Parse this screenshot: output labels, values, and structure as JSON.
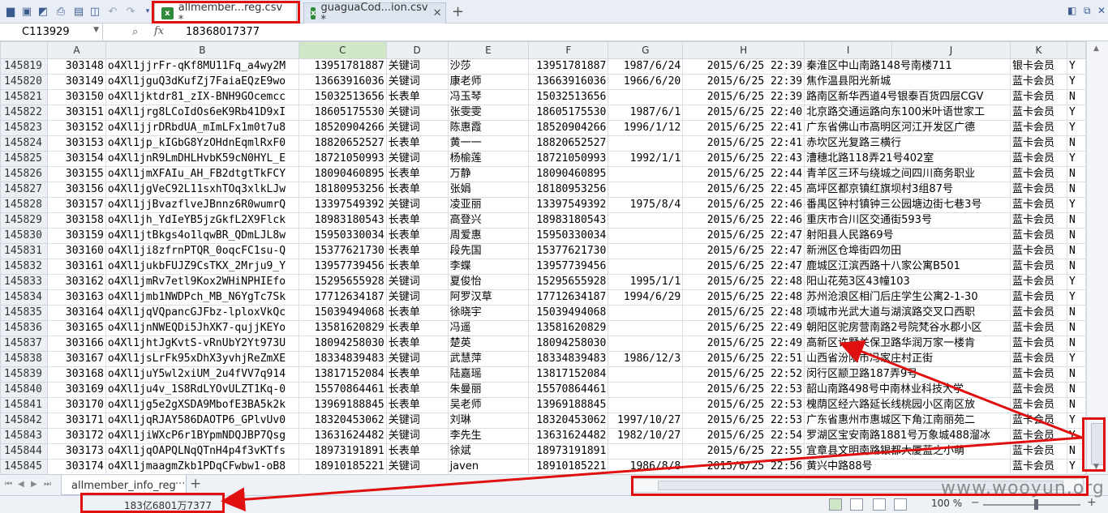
{
  "toolbar": {
    "icons": [
      "folder-icon",
      "save-icon",
      "pdf-icon",
      "print-icon",
      "print-preview-icon",
      "preview-icon",
      "undo-icon",
      "redo-icon",
      "customize-icon"
    ]
  },
  "tabs": [
    {
      "label": "allmember...reg.csv *",
      "active": true
    },
    {
      "label": "guaguaCod...ion.csv *",
      "active": false
    }
  ],
  "tab_close": "✕",
  "formula_bar": {
    "cell_ref": "C113929",
    "fx": "fx",
    "value": "18368017377"
  },
  "columns": [
    "A",
    "B",
    "C",
    "D",
    "E",
    "F",
    "G",
    "H",
    "I",
    "J",
    "K"
  ],
  "selected_column": "C",
  "rows": [
    {
      "n": "145819",
      "a": "303148",
      "b": "o4Xl1jjrFr-qKf8MU11Fq_a4wy2M",
      "c": "13951781887",
      "d": "关键词",
      "e": "沙莎",
      "f": "13951781887",
      "g": "1987/6/24",
      "h": "2015/6/25 22:39",
      "i": "秦淮区中山南路148号南楼711",
      "k": "银卡会员",
      "l": "Y"
    },
    {
      "n": "145820",
      "a": "303149",
      "b": "o4Xl1jguQ3dKufZj7FaiaEQzE9wo",
      "c": "13663916036",
      "d": "关键词",
      "e": "康老师",
      "f": "13663916036",
      "g": "1966/6/20",
      "h": "2015/6/25 22:39",
      "i": "焦作温县阳光新城",
      "k": "蓝卡会员",
      "l": "Y"
    },
    {
      "n": "145821",
      "a": "303150",
      "b": "o4Xl1jktdr81_zIX-BNH9GOcemcc",
      "c": "15032513656",
      "d": "长表单",
      "e": "冯玉琴",
      "f": "15032513656",
      "g": "",
      "h": "2015/6/25 22:39",
      "i": "路南区新华西道4号银泰百货四层CGV",
      "k": "蓝卡会员",
      "l": "N"
    },
    {
      "n": "145822",
      "a": "303151",
      "b": "o4Xl1jrg8LCoIdOs6eK9Rb41D9xI",
      "c": "18605175530",
      "d": "关键词",
      "e": "张雯雯",
      "f": "18605175530",
      "g": "1987/6/1",
      "h": "2015/6/25 22:40",
      "i": "北京路交通运路向东100米叶语世家工",
      "k": "蓝卡会员",
      "l": "Y"
    },
    {
      "n": "145823",
      "a": "303152",
      "b": "o4Xl1jjrDRbdUA_mImLFx1m0t7u8",
      "c": "18520904266",
      "d": "关键词",
      "e": "陈惠霞",
      "f": "18520904266",
      "g": "1996/1/12",
      "h": "2015/6/25 22:41",
      "i": "广东省佛山市高明区河江开发区广德",
      "k": "蓝卡会员",
      "l": "Y"
    },
    {
      "n": "145824",
      "a": "303153",
      "b": "o4Xl1jp_kIGbG8YzOHdnEqmlRxF0",
      "c": "18820652527",
      "d": "长表单",
      "e": "黄一一",
      "f": "18820652527",
      "g": "",
      "h": "2015/6/25 22:41",
      "i": "赤坎区光复路三横行",
      "k": "蓝卡会员",
      "l": "N"
    },
    {
      "n": "145825",
      "a": "303154",
      "b": "o4Xl1jnR9LmDHLHvbK59cN0HYL_E",
      "c": "18721050993",
      "d": "关键词",
      "e": "杨榆莲",
      "f": "18721050993",
      "g": "1992/1/1",
      "h": "2015/6/25 22:43",
      "i": "漕穗北路118弄21号402室",
      "k": "蓝卡会员",
      "l": "Y"
    },
    {
      "n": "145826",
      "a": "303155",
      "b": "o4Xl1jmXFAIu_AH_FB2dtgtTkFCY",
      "c": "18090460895",
      "d": "长表单",
      "e": "万静",
      "f": "18090460895",
      "g": "",
      "h": "2015/6/25 22:44",
      "i": "青羊区三环与绕城之间四川商务职业",
      "k": "蓝卡会员",
      "l": "N"
    },
    {
      "n": "145827",
      "a": "303156",
      "b": "o4Xl1jgVeC92L11sxhTOq3xlkLJw",
      "c": "18180953256",
      "d": "长表单",
      "e": "张娟",
      "f": "18180953256",
      "g": "",
      "h": "2015/6/25 22:45",
      "i": "高坪区都京镇红旗坝村3组87号",
      "k": "蓝卡会员",
      "l": "N"
    },
    {
      "n": "145828",
      "a": "303157",
      "b": "o4Xl1jjBvazflveJBnnz6R0wumrQ",
      "c": "13397549392",
      "d": "关键词",
      "e": "凌亚丽",
      "f": "13397549392",
      "g": "1975/8/4",
      "h": "2015/6/25 22:46",
      "i": "番禺区钟村镇钟三公园塘边街七巷3号",
      "k": "蓝卡会员",
      "l": "Y"
    },
    {
      "n": "145829",
      "a": "303158",
      "b": "o4Xl1jh_YdIeYB5jzGkfL2X9Flck",
      "c": "18983180543",
      "d": "长表单",
      "e": "高登兴",
      "f": "18983180543",
      "g": "",
      "h": "2015/6/25 22:46",
      "i": "重庆市合川区交通街593号",
      "k": "蓝卡会员",
      "l": "N"
    },
    {
      "n": "145830",
      "a": "303159",
      "b": "o4Xl1jtBkgs4o1lqwBR_QDmLJL8w",
      "c": "15950330034",
      "d": "长表单",
      "e": "周爱惠",
      "f": "15950330034",
      "g": "",
      "h": "2015/6/25 22:47",
      "i": "射阳县人民路69号",
      "k": "蓝卡会员",
      "l": "N"
    },
    {
      "n": "145831",
      "a": "303160",
      "b": "o4Xl1ji8zfrnPTQR_0oqcFC1su-Q",
      "c": "15377621730",
      "d": "长表单",
      "e": "段先国",
      "f": "15377621730",
      "g": "",
      "h": "2015/6/25 22:47",
      "i": "新洲区仓埠街四勿田",
      "k": "蓝卡会员",
      "l": "N"
    },
    {
      "n": "145832",
      "a": "303161",
      "b": "o4Xl1jukbFUJZ9CsTKX_2Mrju9_Y",
      "c": "13957739456",
      "d": "长表单",
      "e": "李蝶",
      "f": "13957739456",
      "g": "",
      "h": "2015/6/25 22:47",
      "i": "鹿城区江滨西路十八家公寓B501",
      "k": "蓝卡会员",
      "l": "N"
    },
    {
      "n": "145833",
      "a": "303162",
      "b": "o4Xl1jmRv7etl9Kox2WHiNPHIEfo",
      "c": "15295655928",
      "d": "关键词",
      "e": "夏俊怡",
      "f": "15295655928",
      "g": "1995/1/1",
      "h": "2015/6/25 22:48",
      "i": "阳山花苑3区43幢103",
      "k": "蓝卡会员",
      "l": "Y"
    },
    {
      "n": "145834",
      "a": "303163",
      "b": "o4Xl1jmb1NWDPch_MB_N6YgTc7Sk",
      "c": "17712634187",
      "d": "关键词",
      "e": "阿罗汉草",
      "f": "17712634187",
      "g": "1994/6/29",
      "h": "2015/6/25 22:48",
      "i": "苏州沧浪区相门后庄学生公寓2-1-30",
      "k": "蓝卡会员",
      "l": "Y"
    },
    {
      "n": "145835",
      "a": "303164",
      "b": "o4Xl1jqVQpancGJFbz-lploxVkQc",
      "c": "15039494068",
      "d": "长表单",
      "e": "徐晓宇",
      "f": "15039494068",
      "g": "",
      "h": "2015/6/25 22:48",
      "i": "项城市光武大道与湖滨路交叉口西职",
      "k": "蓝卡会员",
      "l": "N"
    },
    {
      "n": "145836",
      "a": "303165",
      "b": "o4Xl1jnNWEQDi5JhXK7-qujjKEYo",
      "c": "13581620829",
      "d": "长表单",
      "e": "冯遥",
      "f": "13581620829",
      "g": "",
      "h": "2015/6/25 22:49",
      "i": "朝阳区驼房营南路2号院梵谷水郡小区",
      "k": "蓝卡会员",
      "l": "N"
    },
    {
      "n": "145837",
      "a": "303166",
      "b": "o4Xl1jhtJgKvtS-vRnUbY2Yt973U",
      "c": "18094258030",
      "d": "长表单",
      "e": "楚英",
      "f": "18094258030",
      "g": "",
      "h": "2015/6/25 22:49",
      "i": "高新区许墅关保卫路华润万家一楼肯",
      "k": "蓝卡会员",
      "l": "N"
    },
    {
      "n": "145838",
      "a": "303167",
      "b": "o4Xl1jsLrFk95xDhX3yvhjReZmXE",
      "c": "18334839483",
      "d": "关键词",
      "e": "武慧萍",
      "f": "18334839483",
      "g": "1986/12/3",
      "h": "2015/6/25 22:51",
      "i": "山西省汾阳市冯家庄村正街",
      "k": "蓝卡会员",
      "l": "Y"
    },
    {
      "n": "145839",
      "a": "303168",
      "b": "o4Xl1juY5wl2xiUM_2u4fVV7q914",
      "c": "13817152084",
      "d": "长表单",
      "e": "陆嘉瑶",
      "f": "13817152084",
      "g": "",
      "h": "2015/6/25 22:52",
      "i": "闵行区颛卫路187弄9号",
      "k": "蓝卡会员",
      "l": "N"
    },
    {
      "n": "145840",
      "a": "303169",
      "b": "o4Xl1ju4v_1S8RdLYOvULZT1Kq-0",
      "c": "15570864461",
      "d": "长表单",
      "e": "朱曼丽",
      "f": "15570864461",
      "g": "",
      "h": "2015/6/25 22:53",
      "i": "韶山南路498号中南林业科技大学",
      "k": "蓝卡会员",
      "l": "N"
    },
    {
      "n": "145841",
      "a": "303170",
      "b": "o4Xl1jg5e2gXSDA9MbofE3BA5k2k",
      "c": "13969188845",
      "d": "长表单",
      "e": "吴老师",
      "f": "13969188845",
      "g": "",
      "h": "2015/6/25 22:53",
      "i": "槐荫区经六路延长线桃园小区南区放",
      "k": "蓝卡会员",
      "l": "N"
    },
    {
      "n": "145842",
      "a": "303171",
      "b": "o4Xl1jqRJAY586DAOTP6_GPlvUv0",
      "c": "18320453062",
      "d": "关键词",
      "e": "刘琳",
      "f": "18320453062",
      "g": "1997/10/27",
      "h": "2015/6/25 22:53",
      "i": "广东省惠州市惠城区下角江南丽苑二",
      "k": "蓝卡会员",
      "l": "Y"
    },
    {
      "n": "145843",
      "a": "303172",
      "b": "o4Xl1jiWXcP6r1BYpmNDQJBP7Qsg",
      "c": "13631624482",
      "d": "关键词",
      "e": "李先生",
      "f": "13631624482",
      "g": "1982/10/27",
      "h": "2015/6/25 22:54",
      "i": "罗湖区宝安南路1881号万象城488溜冰",
      "k": "蓝卡会员",
      "l": "Y"
    },
    {
      "n": "145844",
      "a": "303173",
      "b": "o4Xl1jqOAPQLNqQTnH4p4f3vKTfs",
      "c": "18973191891",
      "d": "长表单",
      "e": "徐斌",
      "f": "18973191891",
      "g": "",
      "h": "2015/6/25 22:55",
      "i": "宜章县文明南路银都大厦蓝之小萌",
      "k": "蓝卡会员",
      "l": "N"
    },
    {
      "n": "145845",
      "a": "303174",
      "b": "o4Xl1jmaagmZkb1PDqCFwbw1-oB8",
      "c": "18910185221",
      "d": "关键词",
      "e": "javen",
      "f": "18910185221",
      "g": "1986/8/8",
      "h": "2015/6/25 22:56",
      "i": "黄兴中路88号",
      "k": "蓝卡会员",
      "l": "Y"
    }
  ],
  "sheet_tab": "allmember_info_reg",
  "sheet_more": "···",
  "sheet_add": "+",
  "status": {
    "sum": "183亿6801万7377",
    "zoom": "100 %",
    "zoom_minus": "−",
    "zoom_plus": "+"
  },
  "watermark": "www.wooyun.org",
  "annotation_color": "#e01010"
}
